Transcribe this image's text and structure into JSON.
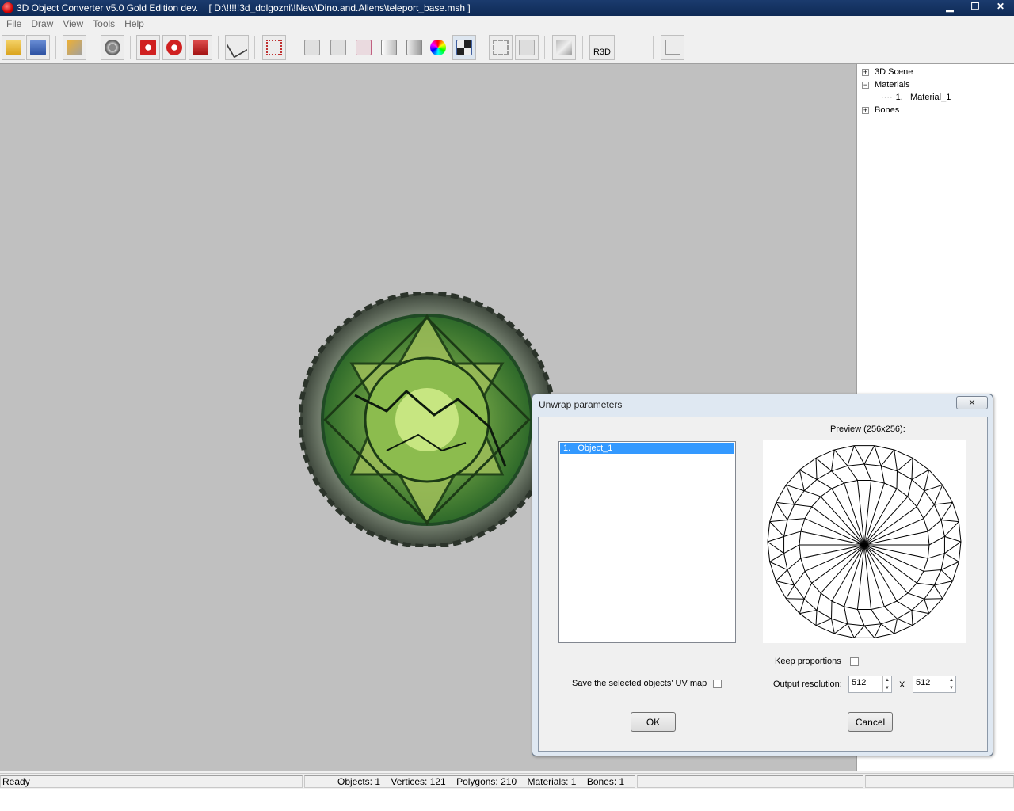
{
  "window": {
    "title": "3D Object Converter v5.0 Gold Edition dev.    [ D:\\!!!!!3d_dolgozni\\!New\\Dino.and.Aliens\\teleport_base.msh ]"
  },
  "menu": [
    "File",
    "Draw",
    "View",
    "Tools",
    "Help"
  ],
  "toolbar": {
    "r3d_label": "R3D"
  },
  "tree": {
    "scene": "3D Scene",
    "materials": "Materials",
    "material_1": "1.   Material_1",
    "bones": "Bones"
  },
  "status": {
    "ready": "Ready",
    "stats": "Objects: 1    Vertices: 121    Polygons: 210    Materials: 1    Bones: 1"
  },
  "dialog": {
    "title": "Unwrap parameters",
    "close": "✕",
    "list_items": [
      "1.   Object_1"
    ],
    "preview_label": "Preview (256x256):",
    "save_uv_label": "Save the selected objects' UV map",
    "keep_proportions_label": "Keep proportions",
    "output_resolution_label": "Output resolution:",
    "res_w": "512",
    "res_x": "X",
    "res_h": "512",
    "ok": "OK",
    "cancel": "Cancel"
  },
  "colors": {
    "titlebar": "#0e2a55",
    "viewport": "#c0c0c0",
    "selection": "#3399ff"
  }
}
